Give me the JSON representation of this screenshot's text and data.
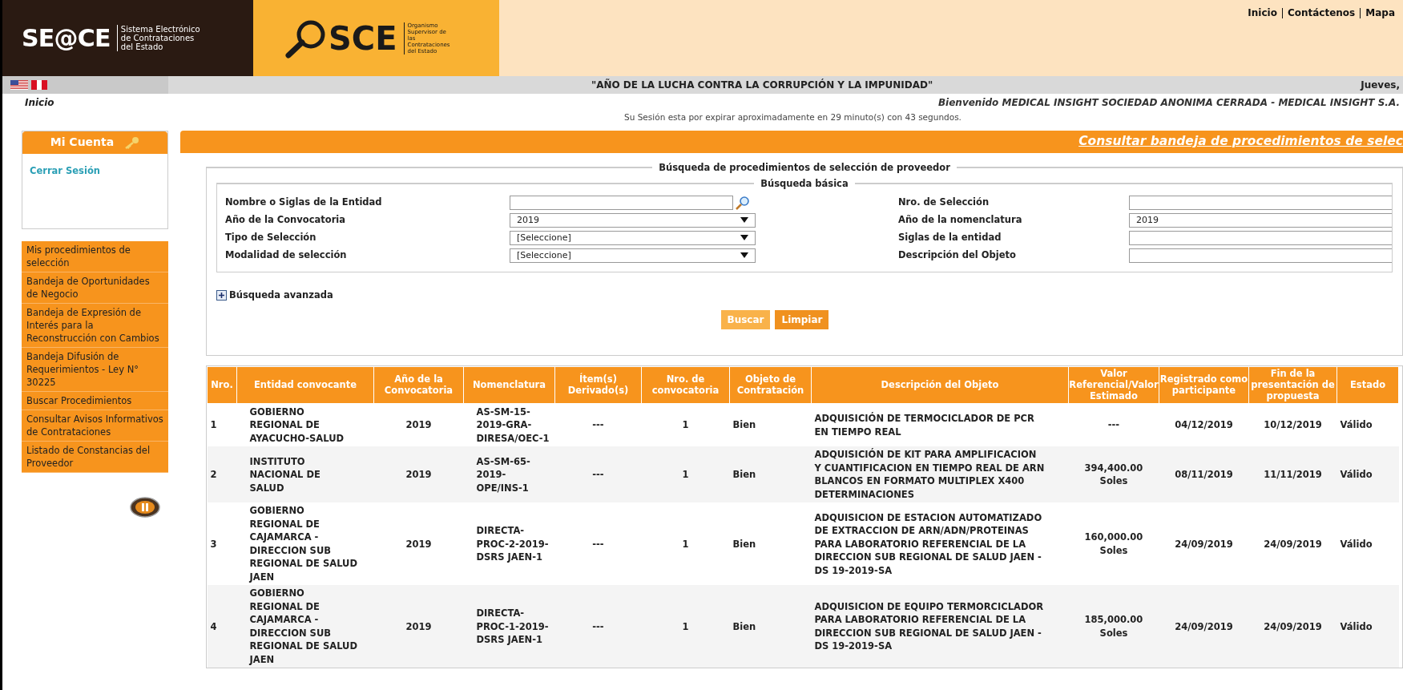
{
  "header": {
    "seace_logo": "SE@CE",
    "seace_subtitle": "Sistema Electrónico de Contrataciones del Estado",
    "osce_logo": "SCE",
    "osce_subtitle": "Organismo Supervisor de las Contrataciones del Estado",
    "top_links": [
      "Inicio",
      "Contáctenos",
      "Mapa"
    ]
  },
  "banner": {
    "motto": "\"AÑO DE LA LUCHA CONTRA LA CORRUPCIÓN Y LA IMPUNIDAD\"",
    "date": "Jueves,"
  },
  "breadcrumb": "Inicio",
  "welcome": "Bienvenido  MEDICAL INSIGHT SOCIEDAD ANONIMA CERRADA - MEDICAL INSIGHT S.A.",
  "session_notice": "Su Sesión esta por expirar aproximadamente en 29 minuto(s) con 43 segundos.",
  "account": {
    "title": "Mi Cuenta",
    "links": [
      "Cerrar Sesión"
    ]
  },
  "menu": [
    "Mis procedimientos de selección",
    "Bandeja de Oportunidades de Negocio",
    "Bandeja de Expresión de Interés para la Reconstrucción con Cambios",
    "Bandeja Difusión de Requerimientos - Ley N° 30225",
    "Buscar Procedimientos",
    "Consultar Avisos Informativos de Contrataciones",
    "Listado de Constancias del Proveedor"
  ],
  "page_title": "Consultar bandeja de procedimientos de selec",
  "search": {
    "title": "Búsqueda de procedimientos de selección de proveedor",
    "basic_title": "Búsqueda básica",
    "left_fields": [
      {
        "label": "Nombre o Siglas de la Entidad",
        "kind": "lookup"
      },
      {
        "label": "Año de la Convocatoria",
        "kind": "select",
        "value": "2019"
      },
      {
        "label": "Tipo de Selección",
        "kind": "select",
        "value": "[Seleccione]"
      },
      {
        "label": "Modalidad de selección",
        "kind": "select",
        "value": "[Seleccione]"
      }
    ],
    "right_fields": [
      {
        "label": "Nro. de Selección"
      },
      {
        "label": "Año de la nomenclatura",
        "value": "2019"
      },
      {
        "label": "Siglas de la entidad"
      },
      {
        "label": "Descripción del Objeto"
      }
    ],
    "advanced": "Búsqueda avanzada",
    "buttons": [
      "Buscar",
      "Limpiar"
    ]
  },
  "table": {
    "columns": [
      "Nro.",
      "Entidad convocante",
      "Año de la Convocatoria",
      "Nomenclatura",
      "Ítem(s) Derivado(s)",
      "Nro. de convocatoria",
      "Objeto de Contratación",
      "Descripción del Objeto",
      "Valor Referencial/Valor Estimado",
      "Registrado como participante",
      "Fin de la presentación de propuesta",
      "Estado"
    ],
    "rows": [
      {
        "cells": [
          "1",
          "GOBIERNO REGIONAL DE AYACUCHO-SALUD",
          "2019",
          "AS-SM-15-2019-GRA-DIRESA/OEC-1",
          "---",
          "1",
          "Bien",
          "ADQUISICIÓN DE TERMOCICLADOR DE PCR EN TIEMPO REAL",
          "---",
          "04/12/2019",
          "10/12/2019",
          "Válido"
        ]
      },
      {
        "cells": [
          "2",
          "INSTITUTO NACIONAL DE SALUD",
          "2019",
          "AS-SM-65-2019-OPE/INS-1",
          "---",
          "1",
          "Bien",
          "ADQUISICIÓN DE KIT PARA AMPLIFICACION Y CUANTIFICACION EN TIEMPO REAL DE ARN BLANCOS EN FORMATO MULTIPLEX X400 DETERMINACIONES",
          "394,400.00 Soles",
          "08/11/2019",
          "11/11/2019",
          "Válido"
        ]
      },
      {
        "cells": [
          "3",
          "GOBIERNO REGIONAL DE CAJAMARCA - DIRECCION SUB REGIONAL DE SALUD JAEN",
          "2019",
          "DIRECTA-PROC-2-2019-DSRS JAEN-1",
          "---",
          "1",
          "Bien",
          "ADQUISICION DE ESTACION AUTOMATIZADO DE EXTRACCION DE ARN/ADN/PROTEINAS PARA LABORATORIO REFERENCIAL DE LA DIRECCION SUB REGIONAL DE SALUD JAEN - DS 19-2019-SA",
          "160,000.00 Soles",
          "24/09/2019",
          "24/09/2019",
          "Válido"
        ]
      },
      {
        "cells": [
          "4",
          "GOBIERNO REGIONAL DE CAJAMARCA - DIRECCION SUB REGIONAL DE SALUD JAEN",
          "2019",
          "DIRECTA-PROC-1-2019-DSRS JAEN-1",
          "---",
          "1",
          "Bien",
          "ADQUISICION DE EQUIPO TERMORCICLADOR PARA LABORATORIO REFERENCIAL DE LA DIRECCION SUB REGIONAL DE SALUD JAEN - DS 19-2019-SA",
          "185,000.00 Soles",
          "24/09/2019",
          "24/09/2019",
          "Válido"
        ]
      }
    ]
  }
}
